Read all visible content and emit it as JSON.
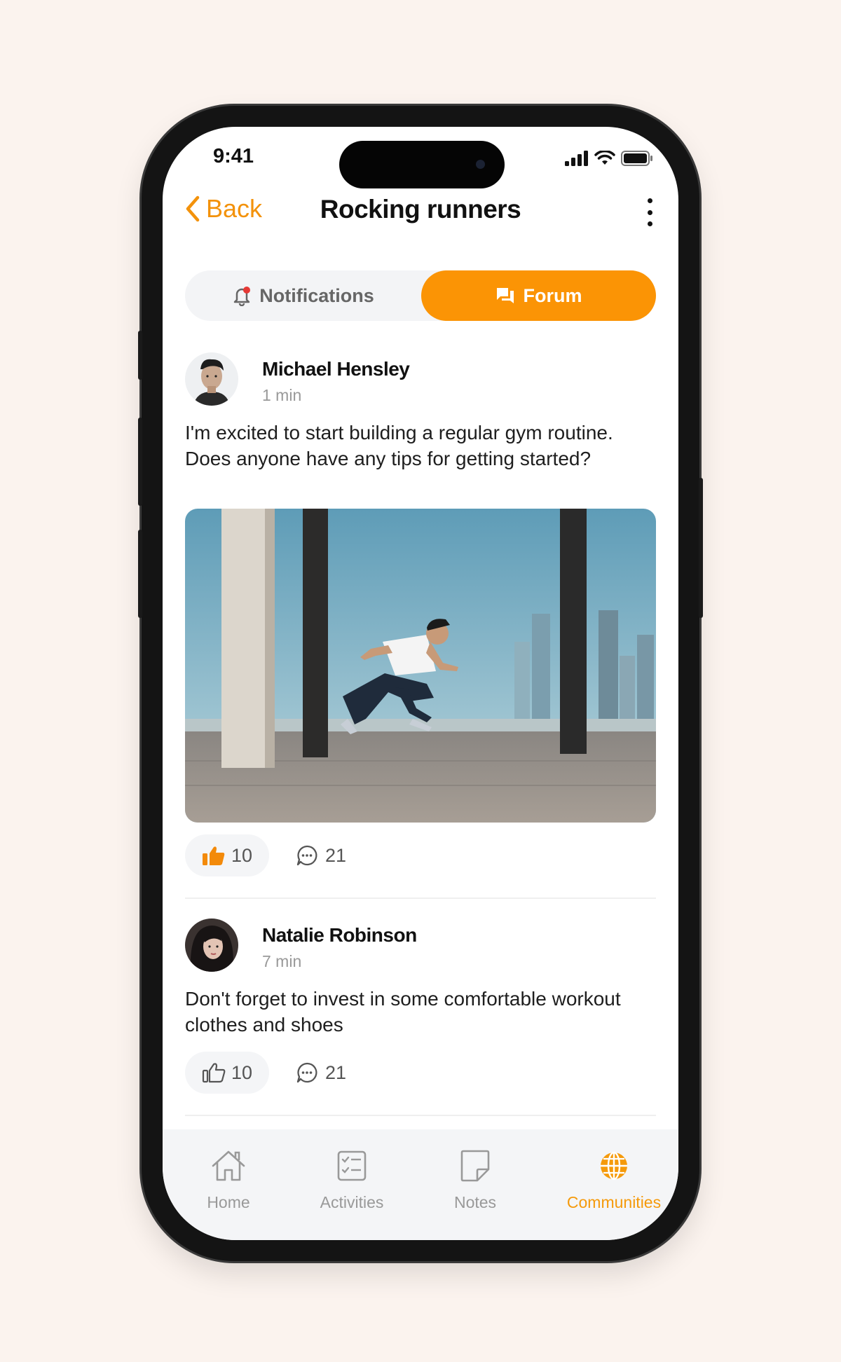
{
  "status_bar": {
    "time": "9:41"
  },
  "nav": {
    "back_label": "Back",
    "title": "Rocking runners"
  },
  "segments": {
    "notifications_label": "Notifications",
    "forum_label": "Forum",
    "active": "Forum"
  },
  "posts": [
    {
      "author": "Michael Hensley",
      "time": "1 min",
      "text": "I'm excited to start building a regular gym routine. Does anyone have any tips for getting started?",
      "likes": "10",
      "comments": "21",
      "liked": true
    },
    {
      "author": "Natalie Robinson",
      "time": "7 min",
      "text": "Don't forget to invest in some comfortable workout clothes and shoes",
      "likes": "10",
      "comments": "21",
      "liked": false
    }
  ],
  "tabbar": {
    "items": [
      {
        "label": "Home",
        "icon": "home-icon"
      },
      {
        "label": "Activities",
        "icon": "checklist-icon"
      },
      {
        "label": "Notes",
        "icon": "note-icon"
      },
      {
        "label": "Communities",
        "icon": "globe-icon"
      }
    ],
    "active": "Communities"
  },
  "colors": {
    "accent": "#fb9405",
    "background": "#fbf3ee"
  }
}
